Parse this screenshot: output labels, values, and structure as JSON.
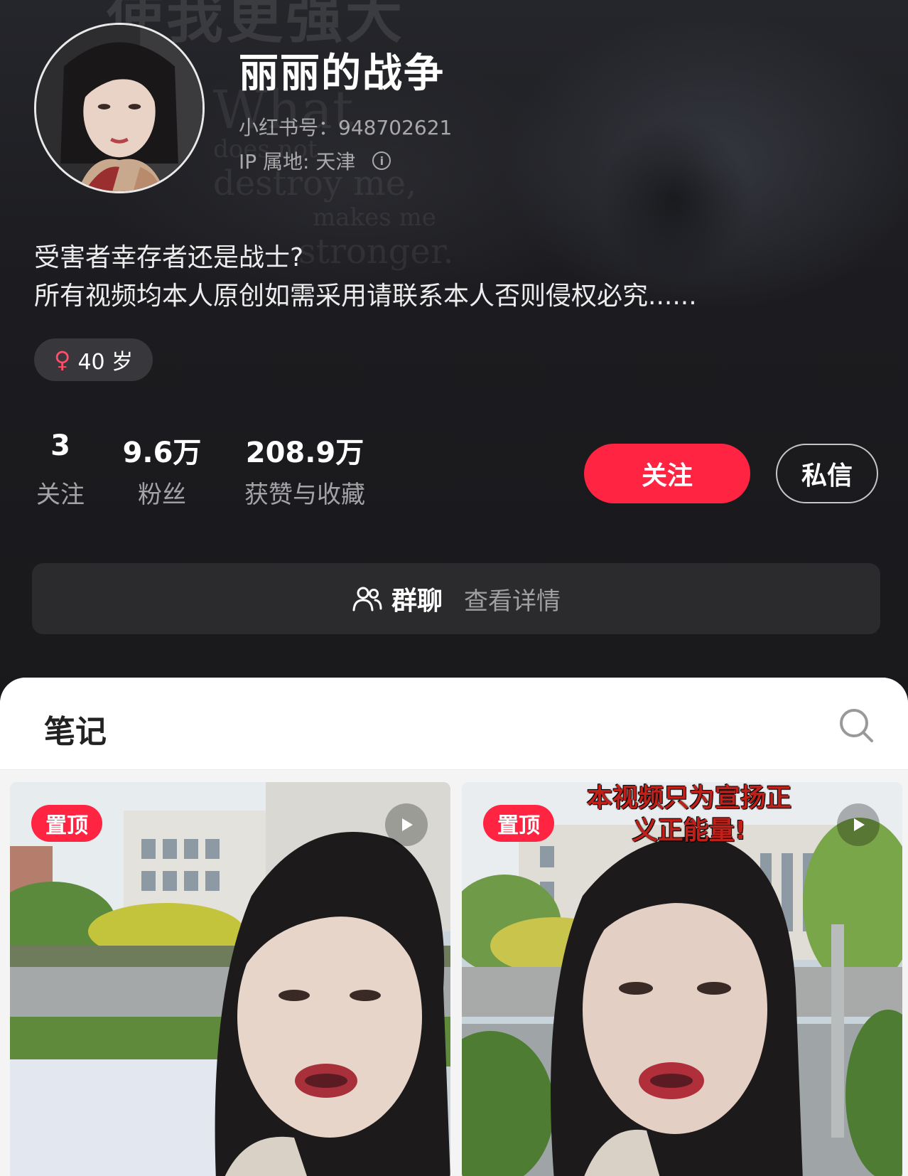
{
  "banner": {
    "top_text": "使我更强大",
    "quote_lines": [
      "What",
      "does not",
      "destroy me,",
      "makes me",
      "stronger."
    ]
  },
  "profile": {
    "nickname": "丽丽的战争",
    "id_line": "小红书号：948702621",
    "ip_line": "IP 属地: 天津",
    "bio_lines": [
      "受害者幸存者还是战士?",
      "所有视频均本人原创如需采用请联系本人否则侵权必究......"
    ],
    "tag_label": "40 岁",
    "gender_icon": "female-icon"
  },
  "stats": [
    {
      "value": "3",
      "label": "关注"
    },
    {
      "value": "9.6万",
      "label": "粉丝"
    },
    {
      "value": "208.9万",
      "label": "获赞与收藏"
    }
  ],
  "actions": {
    "follow_label": "关注",
    "message_label": "私信"
  },
  "group": {
    "label": "群聊",
    "detail": "查看详情"
  },
  "notes": {
    "title": "笔记",
    "cards": [
      {
        "badge": "置顶",
        "caption": ""
      },
      {
        "badge": "置顶",
        "caption": "本视频只为宣扬正义正能量!"
      }
    ]
  },
  "colors": {
    "accent": "#ff2442",
    "background": "#17171a",
    "sheet": "#f4f4f5"
  }
}
